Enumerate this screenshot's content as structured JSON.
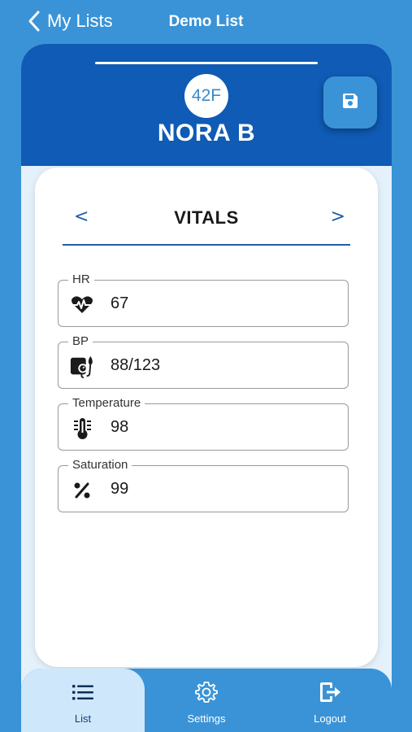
{
  "nav": {
    "back_label": "My Lists",
    "title": "Demo List"
  },
  "patient": {
    "age_sex": "42F",
    "name": "NORA B"
  },
  "section": {
    "prev": "<",
    "title": "VITALS",
    "next": ">"
  },
  "vitals": [
    {
      "label": "HR",
      "value": "67",
      "icon": "heartbeat-icon"
    },
    {
      "label": "BP",
      "value": "88/123",
      "icon": "blood-pressure-cuff-icon"
    },
    {
      "label": "Temperature",
      "value": "98",
      "icon": "thermometer-icon"
    },
    {
      "label": "Saturation",
      "value": "99",
      "icon": "percent-icon"
    }
  ],
  "tabs": {
    "list": "List",
    "settings": "Settings",
    "logout": "Logout"
  },
  "colors": {
    "background": "#3a93d6",
    "header": "#0f5bb5",
    "accent": "#1f5fa6",
    "active_tab": "#cfe7fa"
  }
}
